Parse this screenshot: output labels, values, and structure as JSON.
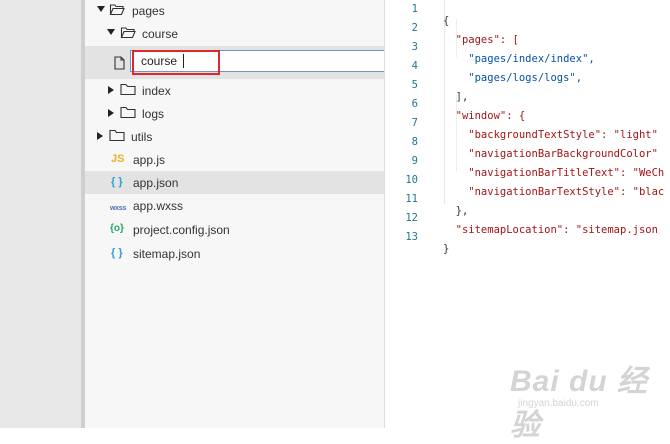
{
  "explorer": {
    "rows": [
      {
        "label": "pages",
        "icon": "folder-open-icon",
        "expanded": true
      },
      {
        "label": "course",
        "icon": "folder-open-icon",
        "expanded": true
      },
      {
        "label": "index",
        "icon": "folder-icon",
        "expanded": false
      },
      {
        "label": "logs",
        "icon": "folder-icon",
        "expanded": false
      },
      {
        "label": "utils",
        "icon": "folder-icon",
        "expanded": false
      },
      {
        "label": "app.js",
        "icon": "js-file-icon",
        "icon_text": "JS"
      },
      {
        "label": "app.json",
        "icon": "json-file-icon",
        "icon_text": "{ }",
        "active": true
      },
      {
        "label": "app.wxss",
        "icon": "wxss-file-icon",
        "icon_text": "wxss"
      },
      {
        "label": "project.config.json",
        "icon": "config-file-icon",
        "icon_text": "{o}"
      },
      {
        "label": "sitemap.json",
        "icon": "json-file-icon",
        "icon_text": "{ }"
      }
    ],
    "rename": {
      "value": "course",
      "icon": "file-icon"
    }
  },
  "editor": {
    "lines": [
      {
        "n": "1",
        "text": "{"
      },
      {
        "n": "2",
        "text": "  \"pages\": ["
      },
      {
        "n": "3",
        "text": "    \"pages/index/index\","
      },
      {
        "n": "4",
        "text": "    \"pages/logs/logs\","
      },
      {
        "n": "5",
        "text": "  ],"
      },
      {
        "n": "6",
        "text": "  \"window\": {"
      },
      {
        "n": "7",
        "text": "    \"backgroundTextStyle\": \"light\""
      },
      {
        "n": "8",
        "text": "    \"navigationBarBackgroundColor\""
      },
      {
        "n": "9",
        "text": "    \"navigationBarTitleText\": \"WeCh"
      },
      {
        "n": "10",
        "text": "    \"navigationBarTextStyle\": \"blac"
      },
      {
        "n": "11",
        "text": "  },"
      },
      {
        "n": "12",
        "text": "  \"sitemapLocation\": \"sitemap.json"
      },
      {
        "n": "13",
        "text": "}"
      }
    ]
  },
  "watermark": {
    "main": "Bai du 经验",
    "sub": "jingyan.baidu.com"
  },
  "colors": {
    "highlight": "#e0282a",
    "input_border": "#6a95d6",
    "json_icon": "#2d9fd9",
    "js_icon": "#e6b422"
  }
}
